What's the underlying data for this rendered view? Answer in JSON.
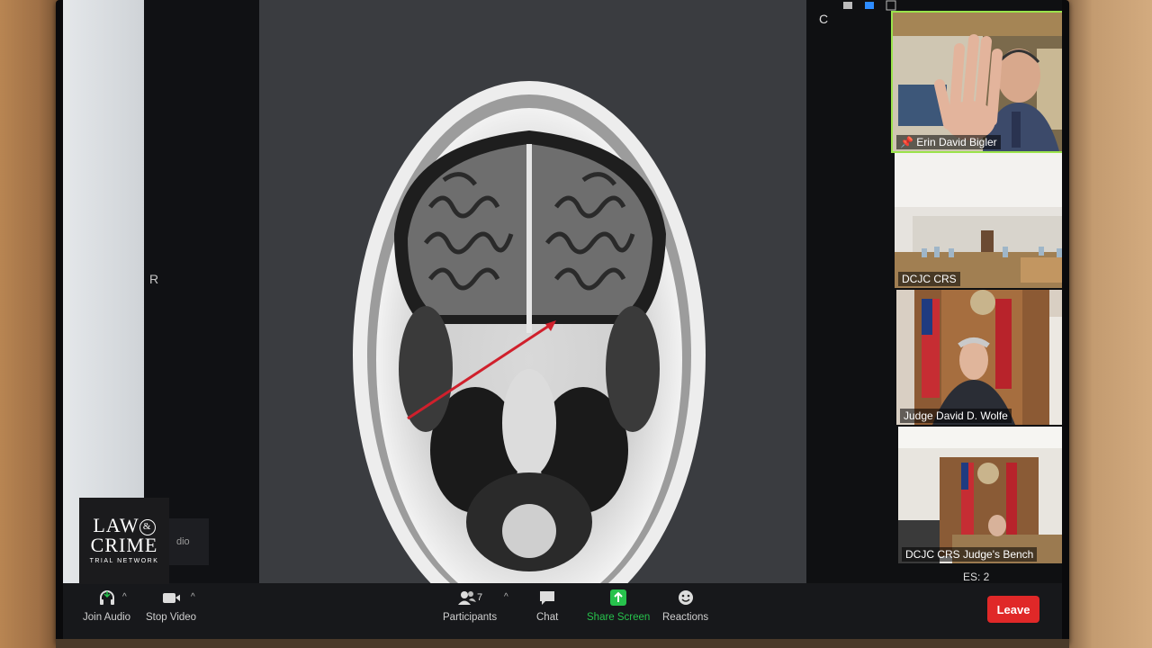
{
  "overlay": {
    "logo_line1": "LAW",
    "logo_amp": "&",
    "logo_line2": "CRIME",
    "logo_line3": "TRIAL NETWORK"
  },
  "shared_screen": {
    "left_label": "R",
    "audio_fragment": "dio"
  },
  "gallery": {
    "top_letter": "C",
    "tiles": [
      {
        "name": "Erin David Bigler",
        "pinned": true,
        "active": true
      },
      {
        "name": "DCJC CRS"
      },
      {
        "name": "Judge David D. Wolfe",
        "more": "···"
      },
      {
        "name": "DCJC CRS Judge's Bench"
      }
    ],
    "page_indicator": "ES: 2"
  },
  "toolbar": {
    "join_audio": "Join Audio",
    "stop_video": "Stop Video",
    "participants": "Participants",
    "participants_count": "7",
    "chat": "Chat",
    "share_screen": "Share Screen",
    "reactions": "Reactions",
    "leave": "Leave"
  },
  "colors": {
    "share_green": "#27c24c",
    "leave_red": "#e02828",
    "active_speaker": "#9be34b",
    "annotation_arrow": "#d0202c"
  }
}
